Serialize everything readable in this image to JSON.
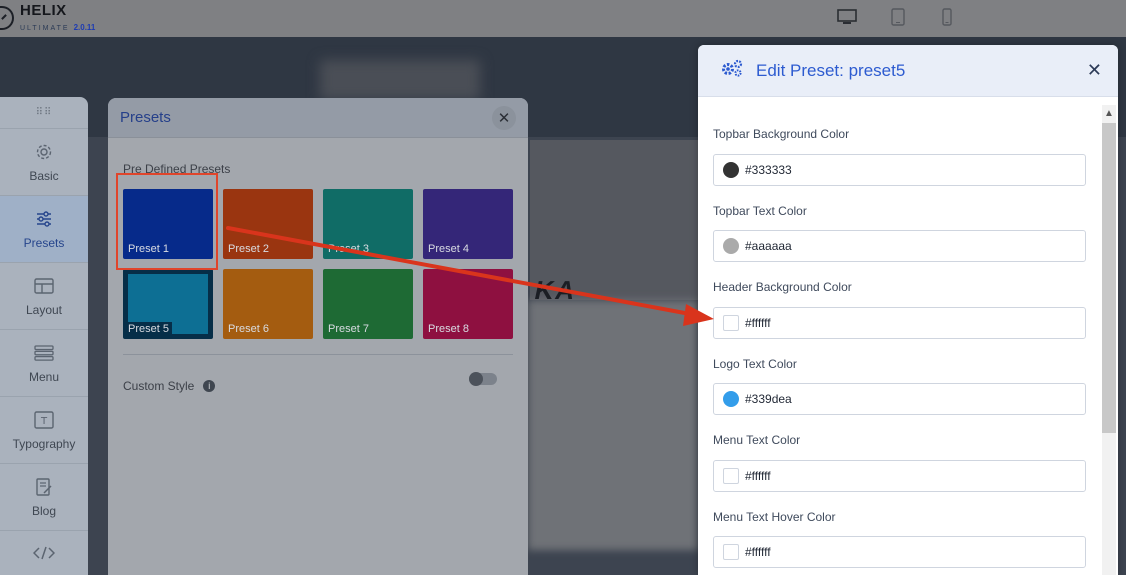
{
  "topbar": {
    "logo_title": "HELIX",
    "logo_sub": "ULTIMATE",
    "logo_version": "2.0.11",
    "devices": [
      {
        "name": "desktop-icon",
        "active": true
      },
      {
        "name": "tablet-icon",
        "active": false
      },
      {
        "name": "mobile-icon",
        "active": false
      }
    ]
  },
  "backdrop": {
    "word": "KA"
  },
  "rail": {
    "items": [
      {
        "label": "Basic",
        "icon": "gear-icon"
      },
      {
        "label": "Presets",
        "icon": "sliders-icon"
      },
      {
        "label": "Layout",
        "icon": "layout-icon"
      },
      {
        "label": "Menu",
        "icon": "menu-icon"
      },
      {
        "label": "Typography",
        "icon": "typography-icon"
      },
      {
        "label": "Blog",
        "icon": "blog-icon"
      },
      {
        "label": "",
        "icon": "code-icon"
      }
    ]
  },
  "presets": {
    "title": "Presets",
    "section_label": "Pre Defined Presets",
    "items": [
      {
        "label": "Preset 1",
        "color": "#062a8a"
      },
      {
        "label": "Preset 2",
        "color": "#9a3510"
      },
      {
        "label": "Preset 3",
        "color": "#106c66"
      },
      {
        "label": "Preset 4",
        "color": "#342678"
      },
      {
        "label": "Preset 5",
        "color": "#062e48"
      },
      {
        "label": "Preset 6",
        "color": "#a45c10"
      },
      {
        "label": "Preset 7",
        "color": "#1e6a34"
      },
      {
        "label": "Preset 8",
        "color": "#8e1040"
      }
    ],
    "custom_style_label": "Custom Style"
  },
  "dialog": {
    "title": "Edit Preset: preset5",
    "fields": [
      {
        "label": "Topbar Background Color",
        "value": "#333333",
        "swatch": "#333333"
      },
      {
        "label": "Topbar Text Color",
        "value": "#aaaaaa",
        "swatch": "#aaaaaa"
      },
      {
        "label": "Header Background Color",
        "value": "#ffffff",
        "swatch": "#ffffff"
      },
      {
        "label": "Logo Text Color",
        "value": "#339dea",
        "swatch": "#339dea"
      },
      {
        "label": "Menu Text Color",
        "value": "#ffffff",
        "swatch": "#ffffff"
      },
      {
        "label": "Menu Text Hover Color",
        "value": "#ffffff",
        "swatch": "#ffffff"
      }
    ]
  },
  "colors": {
    "accent": "#2d5bd0",
    "annotation": "#d9341c"
  }
}
